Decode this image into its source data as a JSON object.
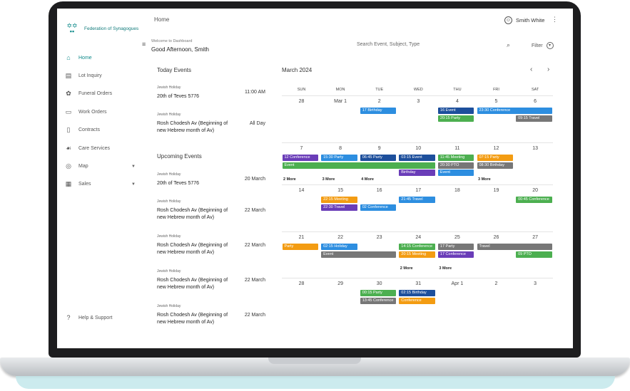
{
  "app": {
    "logo_text": "Federation of Synagogues"
  },
  "header": {
    "breadcrumb": "Home",
    "user_name": "Smith White"
  },
  "welcome": {
    "small": "Welcome to Dashboard",
    "greeting": "Good Afternoon, Smith"
  },
  "search": {
    "placeholder": "Search Event, Subject, Type",
    "filter_label": "Filter"
  },
  "sidebar": {
    "items": [
      {
        "label": "Home",
        "icon": "home-icon"
      },
      {
        "label": "Lot Inquiry",
        "icon": "database-icon"
      },
      {
        "label": "Funeral Orders",
        "icon": "flower-icon"
      },
      {
        "label": "Work Orders",
        "icon": "truck-icon"
      },
      {
        "label": "Contracts",
        "icon": "document-icon"
      },
      {
        "label": "Care Services",
        "icon": "hands-icon"
      },
      {
        "label": "Map",
        "icon": "map-pin-icon"
      },
      {
        "label": "Sales",
        "icon": "cash-register-icon"
      }
    ],
    "help": "Help & Support"
  },
  "today": {
    "title": "Today Events",
    "events": [
      {
        "category": "Jewish Holiday",
        "name": "20th of Teves 5776",
        "time": "11:00 AM"
      },
      {
        "category": "Jewish Holiday",
        "name": "Rosh Chodesh Av (Beginning of new Hebrew month of Av)",
        "time": "All Day"
      }
    ]
  },
  "upcoming": {
    "title": "Upcoming Events",
    "events": [
      {
        "category": "Jewish Holiday",
        "name": "20th of Teves 5776",
        "time": "20 March"
      },
      {
        "category": "Jewish Holiday",
        "name": "Rosh Chodesh Av (Beginning of new Hebrew month of Av)",
        "time": "22 March"
      },
      {
        "category": "Jewish Holiday",
        "name": "Rosh Chodesh Av (Beginning of new Hebrew month of Av)",
        "time": "22 March"
      },
      {
        "category": "Jewish Holiday",
        "name": "Rosh Chodesh Av (Beginning of new Hebrew month of Av)",
        "time": "22 March"
      },
      {
        "category": "Jewish Holiday",
        "name": "Rosh Chodesh Av (Beginning of new Hebrew month of Av)",
        "time": "22 March"
      }
    ]
  },
  "calendar": {
    "title": "March 2024",
    "weekdays": [
      "SUN",
      "MON",
      "TUE",
      "WED",
      "THU",
      "FRI",
      "SAT"
    ],
    "weeks": [
      [
        "28",
        "Mar 1",
        "2",
        "3",
        "4",
        "5",
        "6"
      ],
      [
        "7",
        "8",
        "9",
        "10",
        "11",
        "12",
        "13"
      ],
      [
        "14",
        "15",
        "16",
        "17",
        "18",
        "19",
        "20"
      ],
      [
        "21",
        "22",
        "23",
        "24",
        "25",
        "26",
        "27"
      ],
      [
        "28",
        "29",
        "30",
        "31",
        "Apr 1",
        "2",
        "3"
      ]
    ],
    "colors": {
      "blue": "#2d8ee0",
      "navy": "#1d4f9c",
      "green": "#4caf50",
      "purple": "#6a3db8",
      "gray": "#777777",
      "orange": "#f39c12"
    },
    "events": [
      {
        "week": 0,
        "day": 2,
        "span": 1,
        "row": 0,
        "label": "17 Birthday",
        "color": "blue"
      },
      {
        "week": 0,
        "day": 4,
        "span": 1,
        "row": 0,
        "label": "16 Event",
        "color": "navy"
      },
      {
        "week": 0,
        "day": 5,
        "span": 2,
        "row": 0,
        "label": "23:30 Conference",
        "color": "blue"
      },
      {
        "week": 0,
        "day": 4,
        "span": 1,
        "row": 1,
        "label": "20:15 Party",
        "color": "green"
      },
      {
        "week": 0,
        "day": 6,
        "span": 1,
        "row": 1,
        "label": "09:15 Travel",
        "color": "gray"
      },
      {
        "week": 1,
        "day": 0,
        "span": 1,
        "row": 0,
        "label": "12 Conference",
        "color": "purple"
      },
      {
        "week": 1,
        "day": 1,
        "span": 1,
        "row": 0,
        "label": "15:30 Party",
        "color": "blue"
      },
      {
        "week": 1,
        "day": 2,
        "span": 1,
        "row": 0,
        "label": "06:45 Party",
        "color": "navy"
      },
      {
        "week": 1,
        "day": 3,
        "span": 1,
        "row": 0,
        "label": "03:15 Event",
        "color": "navy"
      },
      {
        "week": 1,
        "day": 4,
        "span": 1,
        "row": 0,
        "label": "11:45 Meeting",
        "color": "green"
      },
      {
        "week": 1,
        "day": 5,
        "span": 1,
        "row": 0,
        "label": "07:15 Party",
        "color": "orange"
      },
      {
        "week": 1,
        "day": 0,
        "span": 4,
        "row": 1,
        "label": "Event",
        "color": "green"
      },
      {
        "week": 1,
        "day": 4,
        "span": 1,
        "row": 1,
        "label": "20:30 PTO",
        "color": "gray"
      },
      {
        "week": 1,
        "day": 5,
        "span": 1,
        "row": 1,
        "label": "08:30 Birthday",
        "color": "gray"
      },
      {
        "week": 1,
        "day": 3,
        "span": 1,
        "row": 2,
        "label": "Birthday",
        "color": "purple"
      },
      {
        "week": 1,
        "day": 4,
        "span": 1,
        "row": 2,
        "label": "Event",
        "color": "blue"
      },
      {
        "week": 2,
        "day": 1,
        "span": 1,
        "row": 0,
        "label": "22:15 Meeting",
        "color": "orange"
      },
      {
        "week": 2,
        "day": 3,
        "span": 1,
        "row": 0,
        "label": "21:45 Travel",
        "color": "blue"
      },
      {
        "week": 2,
        "day": 6,
        "span": 1,
        "row": 0,
        "label": "00:45 Conference",
        "color": "green"
      },
      {
        "week": 2,
        "day": 1,
        "span": 1,
        "row": 1,
        "label": "22:30 Travel",
        "color": "purple"
      },
      {
        "week": 2,
        "day": 2,
        "span": 1,
        "row": 1,
        "label": "02 Conference",
        "color": "blue"
      },
      {
        "week": 3,
        "day": 0,
        "span": 1,
        "row": 0,
        "label": "Party",
        "color": "orange"
      },
      {
        "week": 3,
        "day": 1,
        "span": 1,
        "row": 0,
        "label": "02:15 Holiday",
        "color": "blue"
      },
      {
        "week": 3,
        "day": 3,
        "span": 1,
        "row": 0,
        "label": "14:15 Conference",
        "color": "green"
      },
      {
        "week": 3,
        "day": 4,
        "span": 1,
        "row": 0,
        "label": "17 Party",
        "color": "gray"
      },
      {
        "week": 3,
        "day": 5,
        "span": 2,
        "row": 0,
        "label": "Travel",
        "color": "gray"
      },
      {
        "week": 3,
        "day": 1,
        "span": 2,
        "row": 1,
        "label": "Event",
        "color": "gray"
      },
      {
        "week": 3,
        "day": 3,
        "span": 1,
        "row": 1,
        "label": "20:15 Meeting",
        "color": "orange"
      },
      {
        "week": 3,
        "day": 4,
        "span": 1,
        "row": 1,
        "label": "17 Conference",
        "color": "purple"
      },
      {
        "week": 3,
        "day": 6,
        "span": 1,
        "row": 1,
        "label": "09 PTO",
        "color": "green"
      },
      {
        "week": 4,
        "day": 2,
        "span": 1,
        "row": 0,
        "label": "00:15 Party",
        "color": "green"
      },
      {
        "week": 4,
        "day": 3,
        "span": 1,
        "row": 0,
        "label": "02:15 Birthday",
        "color": "navy"
      },
      {
        "week": 4,
        "day": 2,
        "span": 1,
        "row": 1,
        "label": "13:45 Conference",
        "color": "gray"
      },
      {
        "week": 4,
        "day": 3,
        "span": 1,
        "row": 1,
        "label": "Conference",
        "color": "orange"
      }
    ],
    "more": [
      {
        "week": 1,
        "day": 0,
        "label": "2 More"
      },
      {
        "week": 1,
        "day": 1,
        "label": "3 More"
      },
      {
        "week": 1,
        "day": 2,
        "label": "4 More"
      },
      {
        "week": 1,
        "day": 5,
        "label": "3 More"
      },
      {
        "week": 3,
        "day": 3,
        "label": "2 More"
      },
      {
        "week": 3,
        "day": 4,
        "label": "3 More"
      }
    ]
  }
}
